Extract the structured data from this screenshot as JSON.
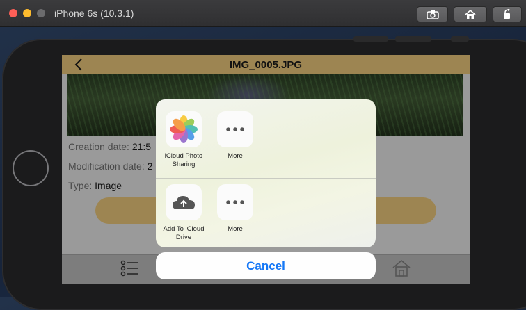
{
  "window": {
    "title": "iPhone 6s (10.3.1)",
    "toolbar": {
      "screenshot_icon": "camera-icon",
      "home_icon": "home-icon",
      "rotate_icon": "rotate-icon"
    }
  },
  "app": {
    "navbar": {
      "title": "IMG_0005.JPG",
      "back_icon": "chevron-left-icon"
    },
    "info": {
      "creation_label": "Creation date:",
      "creation_value": "21:5",
      "modification_label": "Modification date:",
      "modification_value": "2",
      "type_label": "Type:",
      "type_value": "Image"
    },
    "tabbar": {
      "list_icon": "list-icon",
      "home_icon": "house-icon"
    }
  },
  "share_sheet": {
    "row1": [
      {
        "label": "iCloud Photo Sharing",
        "icon": "photos-icon"
      },
      {
        "label": "More",
        "icon": "more-icon"
      }
    ],
    "row2": [
      {
        "label": "Add To iCloud Drive",
        "icon": "icloud-upload-icon"
      },
      {
        "label": "More",
        "icon": "more-icon"
      }
    ],
    "cancel_label": "Cancel"
  },
  "colors": {
    "accent_gold": "#9d8552",
    "cancel_blue": "#1477f6"
  }
}
